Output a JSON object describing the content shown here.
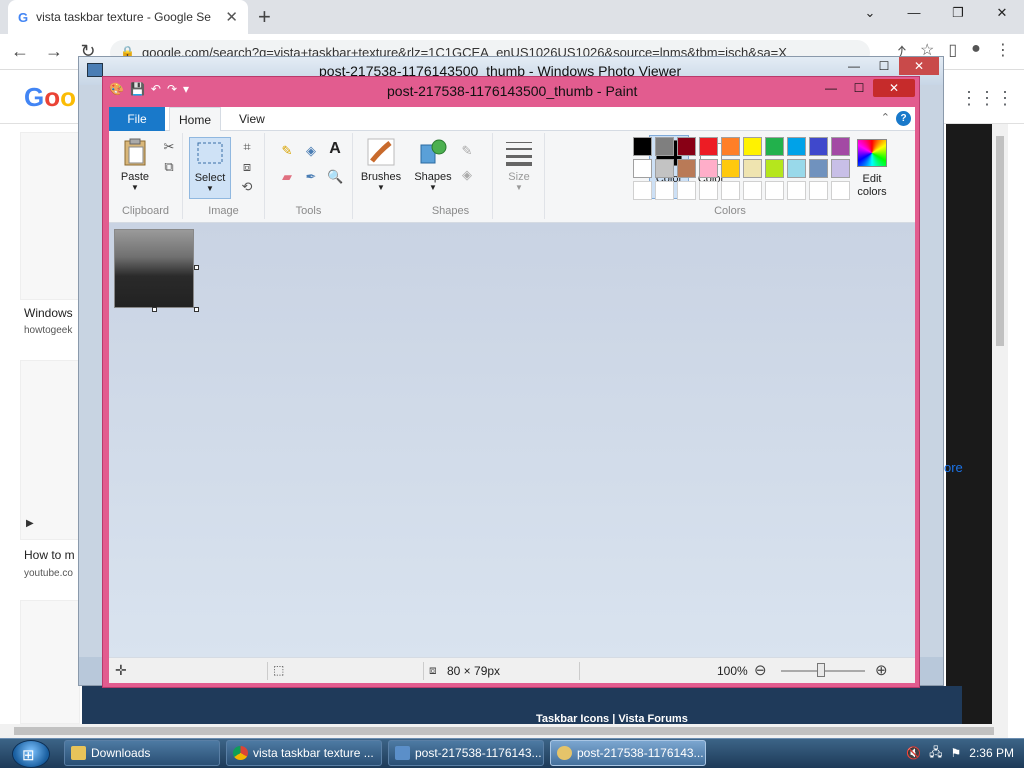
{
  "chrome": {
    "tab_title": "vista taskbar texture - Google Se",
    "tab_close": "✕",
    "new_tab": "+",
    "url": "google.com/search?q=vista+taskbar+texture&rlz=1C1GCEA_enUS1026US1026&source=lnms&tbm=isch&sa=X",
    "results": [
      {
        "title": "Windows",
        "source": "howtogeek"
      },
      {
        "title": "How to m",
        "source": "youtube.co"
      }
    ],
    "more_link": "ore",
    "bottom_caption": "Taskbar Icons | Vista Forums"
  },
  "photo_viewer": {
    "title": "post-217538-1176143500_thumb - Windows Photo Viewer"
  },
  "paint": {
    "title": "post-217538-1176143500_thumb - Paint",
    "tabs": {
      "file": "File",
      "home": "Home",
      "view": "View"
    },
    "groups": {
      "clipboard": "Clipboard",
      "image": "Image",
      "tools": "Tools",
      "shapes": "Shapes",
      "colors": "Colors"
    },
    "buttons": {
      "paste": "Paste",
      "select": "Select",
      "brushes": "Brushes",
      "shapes": "Shapes",
      "size": "Size",
      "color1_line1": "Color",
      "color1_line2": "1",
      "color2_line1": "Color",
      "color2_line2": "2",
      "edit_colors_line1": "Edit",
      "edit_colors_line2": "colors"
    },
    "palette_row1": [
      "#000000",
      "#7f7f7f",
      "#880015",
      "#ed1c24",
      "#ff7f27",
      "#fff200",
      "#22b14c",
      "#00a2e8",
      "#3f48cc",
      "#a349a4"
    ],
    "palette_row2": [
      "#ffffff",
      "#c3c3c3",
      "#b97a57",
      "#ffaec9",
      "#ffc90e",
      "#efe4b0",
      "#b5e61d",
      "#99d9ea",
      "#7092be",
      "#c8bfe7"
    ],
    "status": {
      "image_size": "80 × 79px",
      "zoom": "100%"
    }
  },
  "taskbar": {
    "items": [
      {
        "label": "Downloads"
      },
      {
        "label": "vista taskbar texture ..."
      },
      {
        "label": "post-217538-1176143..."
      },
      {
        "label": "post-217538-1176143..."
      }
    ],
    "clock": "2:36 PM"
  }
}
